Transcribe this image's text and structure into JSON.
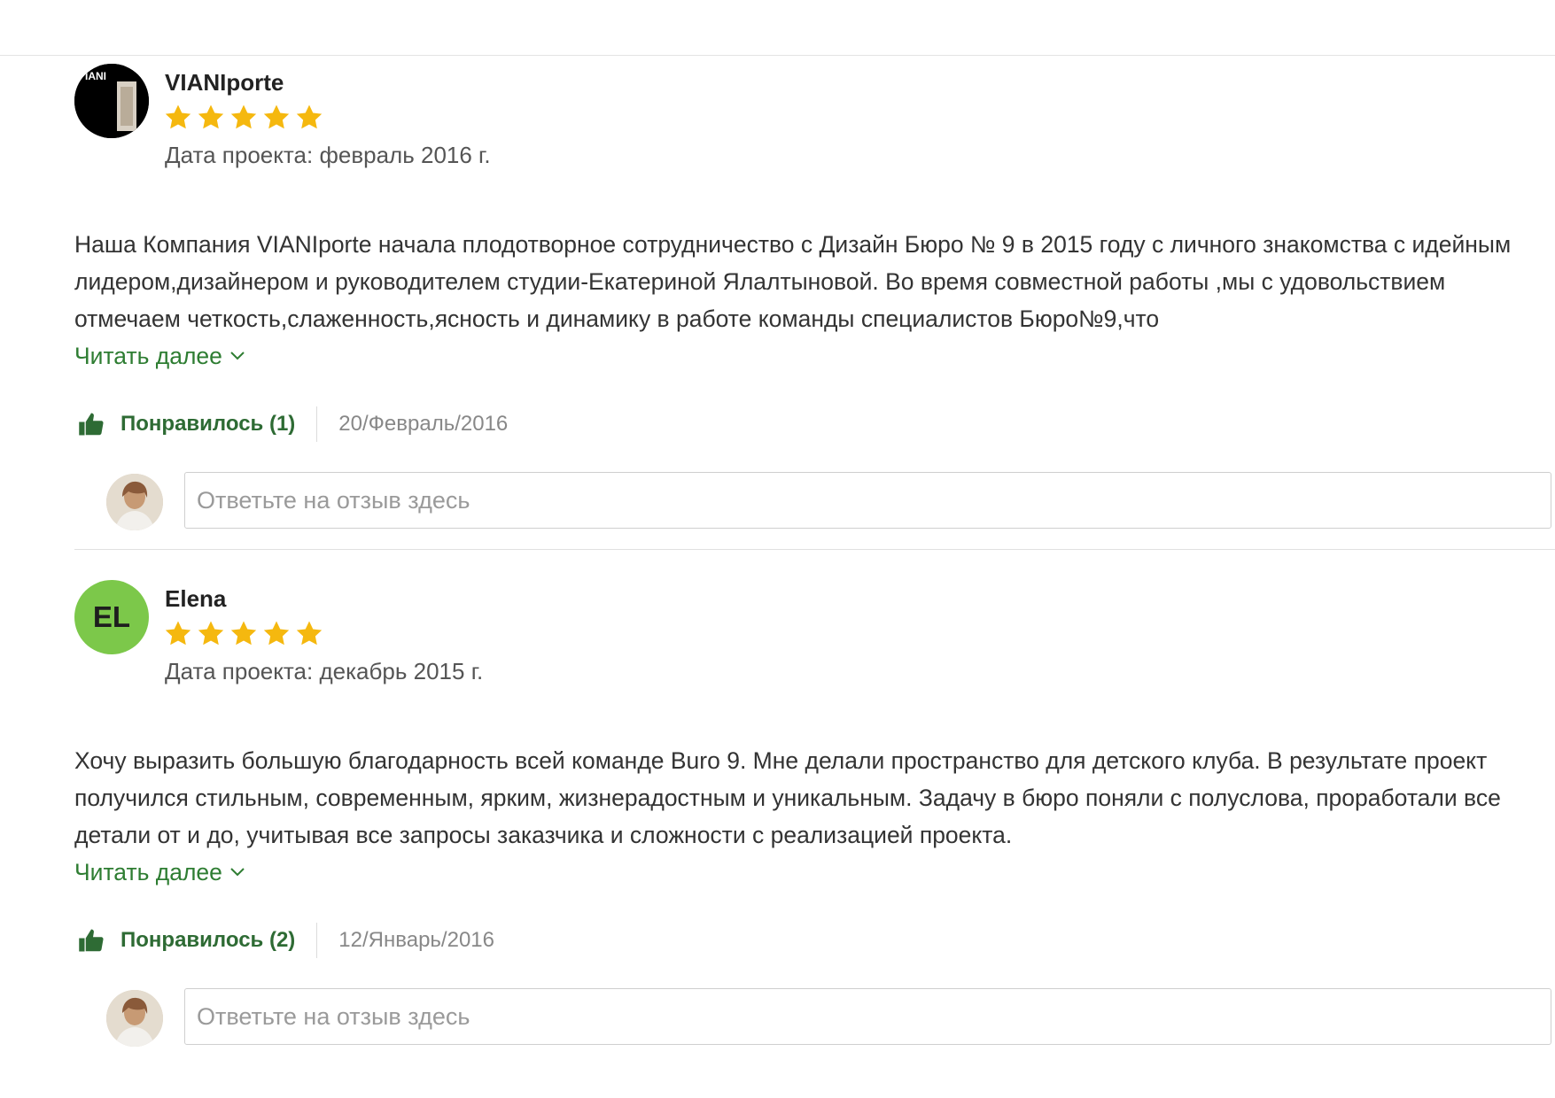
{
  "accent": {
    "green": "#2e7d32",
    "star": "#f5b80f",
    "avatar_green": "#7cc84a"
  },
  "reviews": [
    {
      "author": "VIANIporte",
      "avatar_type": "logo",
      "avatar_logo_text": "IANI",
      "rating": 5,
      "project_date_label": "Дата проекта:",
      "project_date_value": "февраль 2016 г.",
      "body": "Наша Компания VIANIporte начала плодотворное сотрудничество с Дизайн Бюро № 9 в 2015 году с личного знакомства с идейным лидером,дизайнером и руководителем студии-Екатериной Ялалтыновой. Во время совместной работы ,мы с удовольствием отмечаем четкость,слаженность,ясность и динамику в работе команды специалистов Бюро№9,что",
      "read_more": "Читать далее",
      "like_label": "Понравилось (1)",
      "date": "20/Февраль/2016",
      "reply_placeholder": "Ответьте на отзыв здесь"
    },
    {
      "author": "Elena",
      "avatar_type": "initials",
      "avatar_initials": "EL",
      "rating": 5,
      "project_date_label": "Дата проекта:",
      "project_date_value": "декабрь 2015 г.",
      "body": "Хочу выразить большую благодарность всей команде Buro 9.  Мне делали пространство для детского клуба. В результате проект получился стильным, современным, ярким, жизнерадостным и уникальным. Задачу в бюро поняли с полуслова, проработали все детали от и до, учитывая все запросы заказчика и сложности с реализацией проекта.",
      "read_more": "Читать далее",
      "like_label": "Понравилось (2)",
      "date": "12/Январь/2016",
      "reply_placeholder": "Ответьте на отзыв здесь"
    }
  ],
  "icons": {
    "star": "star-icon",
    "like": "thumbs-up-icon",
    "chevron": "chevron-down-icon"
  }
}
